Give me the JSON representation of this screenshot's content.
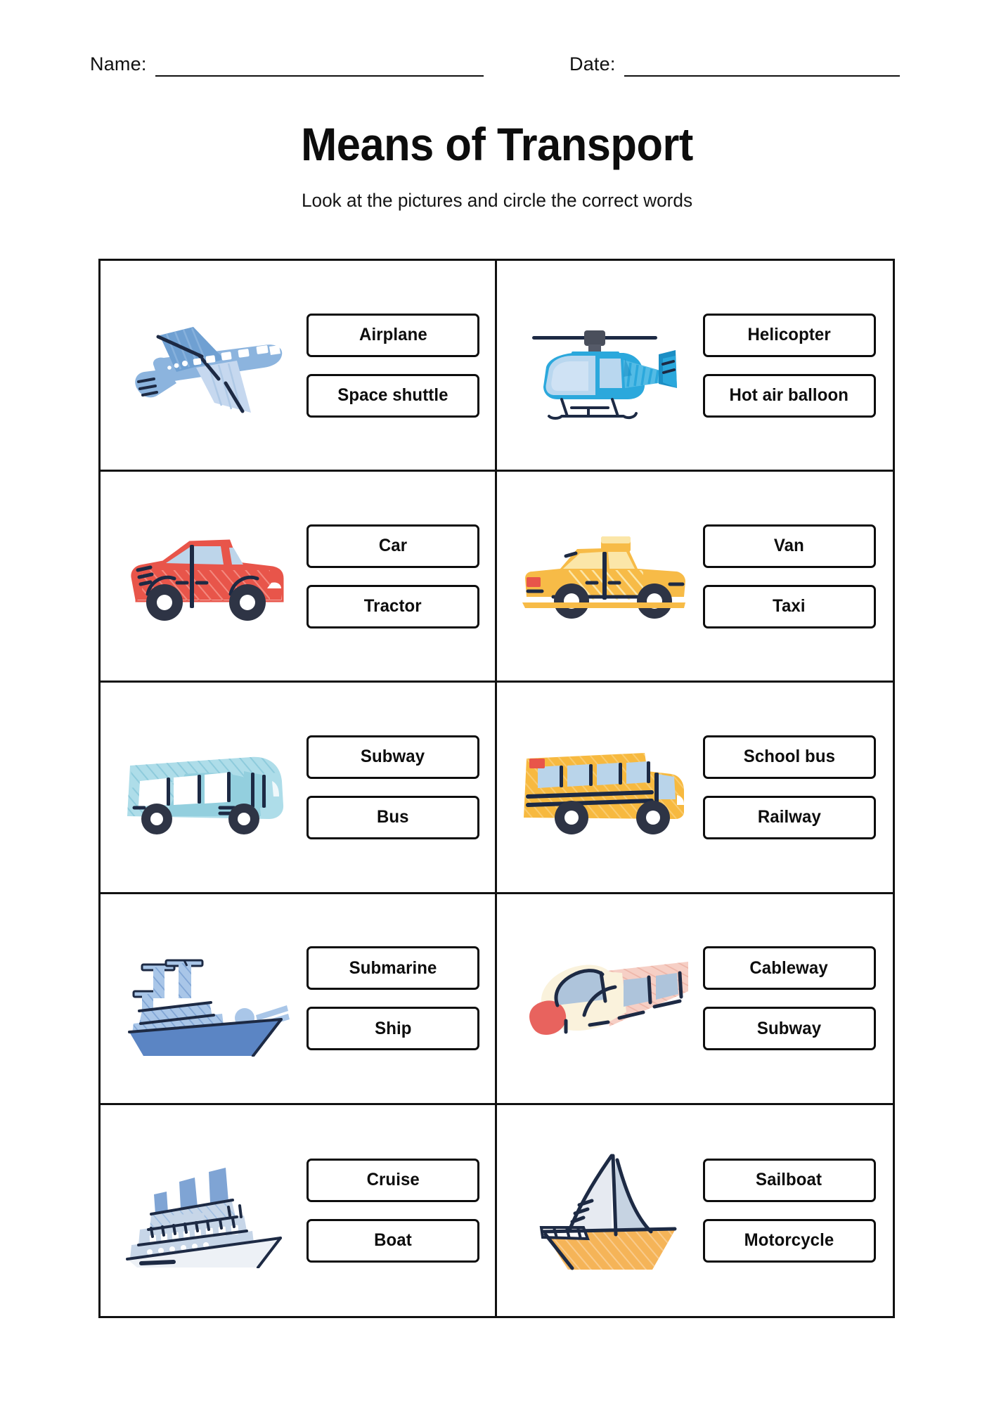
{
  "meta": {
    "name_label": "Name:",
    "date_label": "Date:"
  },
  "header": {
    "title": "Means of Transport",
    "subtitle": "Look at the pictures and circle the correct words"
  },
  "colors": {
    "outline": "#1d2a44",
    "ink": "#0d0d0d",
    "airplane_body": "#8CB4DE",
    "airplane_wing_light": "#C6D8EF",
    "helicopter_body": "#2BA8DC",
    "helicopter_glass": "#B9D7EF",
    "car_red": "#E8554A",
    "car_glass": "#BDD5EA",
    "taxi_yellow": "#F7BB47",
    "taxi_yellow_light": "#FBE6A8",
    "bus_cyan": "#AEDDE9",
    "bus_cyan_dark": "#93CFDE",
    "schoolbus_yellow": "#F7B93F",
    "schoolbus_glass": "#B9D4EA",
    "ship_hull": "#5B85C4",
    "ship_deck": "#A9C6E8",
    "train_cream": "#FAF2DC",
    "train_red": "#E8635E",
    "train_pink": "#F6CFC5",
    "train_glass": "#AEC4DB",
    "cruise_white": "#EDF1F6",
    "cruise_blue": "#7FA4D4",
    "cruise_deck": "#C7D6E8",
    "sail_orange": "#F5B458",
    "sail_white": "#E6EAF1",
    "sail_grey": "#C6D3E2",
    "wheel": "#2E3445"
  },
  "exercises": [
    {
      "id": "airplane",
      "icon": "airplane-illustration",
      "options": [
        {
          "label": "Airplane"
        },
        {
          "label": "Space shuttle"
        }
      ]
    },
    {
      "id": "helicopter",
      "icon": "helicopter-illustration",
      "options": [
        {
          "label": "Helicopter"
        },
        {
          "label": "Hot air balloon"
        }
      ]
    },
    {
      "id": "car",
      "icon": "car-illustration",
      "options": [
        {
          "label": "Car"
        },
        {
          "label": "Tractor"
        }
      ]
    },
    {
      "id": "taxi",
      "icon": "taxi-illustration",
      "options": [
        {
          "label": "Van"
        },
        {
          "label": "Taxi"
        }
      ]
    },
    {
      "id": "bus",
      "icon": "bus-illustration",
      "options": [
        {
          "label": "Subway"
        },
        {
          "label": "Bus"
        }
      ]
    },
    {
      "id": "school-bus",
      "icon": "school-bus-illustration",
      "options": [
        {
          "label": "School bus"
        },
        {
          "label": "Railway"
        }
      ]
    },
    {
      "id": "ship",
      "icon": "ship-illustration",
      "options": [
        {
          "label": "Submarine"
        },
        {
          "label": "Ship"
        }
      ]
    },
    {
      "id": "train",
      "icon": "bullet-train-illustration",
      "options": [
        {
          "label": "Cableway"
        },
        {
          "label": "Subway"
        }
      ]
    },
    {
      "id": "cruise",
      "icon": "cruise-ship-illustration",
      "options": [
        {
          "label": "Cruise"
        },
        {
          "label": "Boat"
        }
      ]
    },
    {
      "id": "sailboat",
      "icon": "sailboat-illustration",
      "options": [
        {
          "label": "Sailboat"
        },
        {
          "label": "Motorcycle"
        }
      ]
    }
  ]
}
